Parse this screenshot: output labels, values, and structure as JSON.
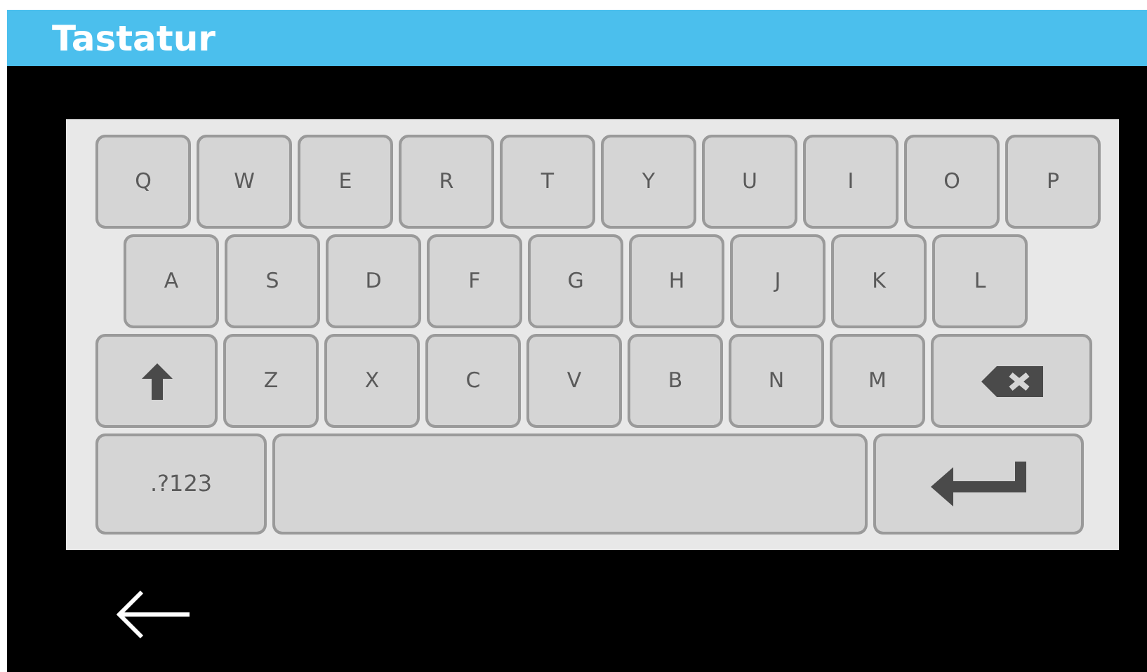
{
  "window": {
    "title": "Tastatur"
  },
  "keyboard": {
    "rows": [
      [
        {
          "kind": "letter",
          "label": "Q"
        },
        {
          "kind": "letter",
          "label": "W"
        },
        {
          "kind": "letter",
          "label": "E"
        },
        {
          "kind": "letter",
          "label": "R"
        },
        {
          "kind": "letter",
          "label": "T"
        },
        {
          "kind": "letter",
          "label": "Y"
        },
        {
          "kind": "letter",
          "label": "U"
        },
        {
          "kind": "letter",
          "label": "I"
        },
        {
          "kind": "letter",
          "label": "O"
        },
        {
          "kind": "letter",
          "label": "P"
        }
      ],
      [
        {
          "kind": "letter",
          "label": "A"
        },
        {
          "kind": "letter",
          "label": "S"
        },
        {
          "kind": "letter",
          "label": "D"
        },
        {
          "kind": "letter",
          "label": "F"
        },
        {
          "kind": "letter",
          "label": "G"
        },
        {
          "kind": "letter",
          "label": "H"
        },
        {
          "kind": "letter",
          "label": "J"
        },
        {
          "kind": "letter",
          "label": "K"
        },
        {
          "kind": "letter",
          "label": "L"
        }
      ],
      [
        {
          "kind": "shift"
        },
        {
          "kind": "letter",
          "label": "Z"
        },
        {
          "kind": "letter",
          "label": "X"
        },
        {
          "kind": "letter",
          "label": "C"
        },
        {
          "kind": "letter",
          "label": "V"
        },
        {
          "kind": "letter",
          "label": "B"
        },
        {
          "kind": "letter",
          "label": "N"
        },
        {
          "kind": "letter",
          "label": "M"
        },
        {
          "kind": "backspace"
        }
      ],
      [
        {
          "kind": "symbols",
          "label": ".?123"
        },
        {
          "kind": "space"
        },
        {
          "kind": "enter"
        }
      ]
    ]
  }
}
